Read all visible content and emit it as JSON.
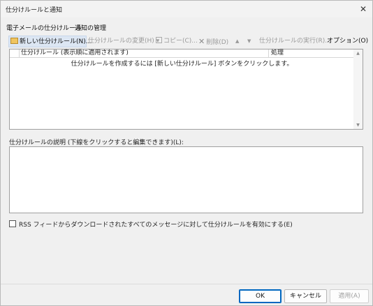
{
  "window": {
    "title": "仕分けルールと通知",
    "close_glyph": "✕"
  },
  "tabs": [
    {
      "label": "電子メールの仕分けルール"
    },
    {
      "label": "通知の管理"
    }
  ],
  "toolbar": {
    "new_rule": "新しい仕分けルール(N)...",
    "change_rule": "仕分けルールの変更(H) ▾",
    "copy": "コピー(C)...",
    "delete": "削除(D)",
    "move_up_glyph": "▲",
    "move_down_glyph": "▼",
    "run_rules": "仕分けルールの実行(R)...",
    "options": "オプション(O)"
  },
  "rules_list": {
    "columns": [
      {
        "label": "仕分けルール (表示順に適用されます)"
      },
      {
        "label": "処理"
      }
    ],
    "empty_message": "仕分けルールを作成するには [新しい仕分けルール] ボタンをクリックします。",
    "rows": []
  },
  "description": {
    "label": "仕分けルールの説明 (下線をクリックすると編集できます)(L):",
    "text": ""
  },
  "rss": {
    "label": "RSS フィードからダウンロードされたすべてのメッセージに対して仕分けルールを有効にする(E)",
    "checked": false
  },
  "buttons": {
    "ok": "OK",
    "cancel": "キャンセル",
    "apply": "適用(A)"
  },
  "colors": {
    "accent": "#0067c0",
    "dialog_bg": "#f0f0f0",
    "disabled_text": "#9a9a9a"
  }
}
